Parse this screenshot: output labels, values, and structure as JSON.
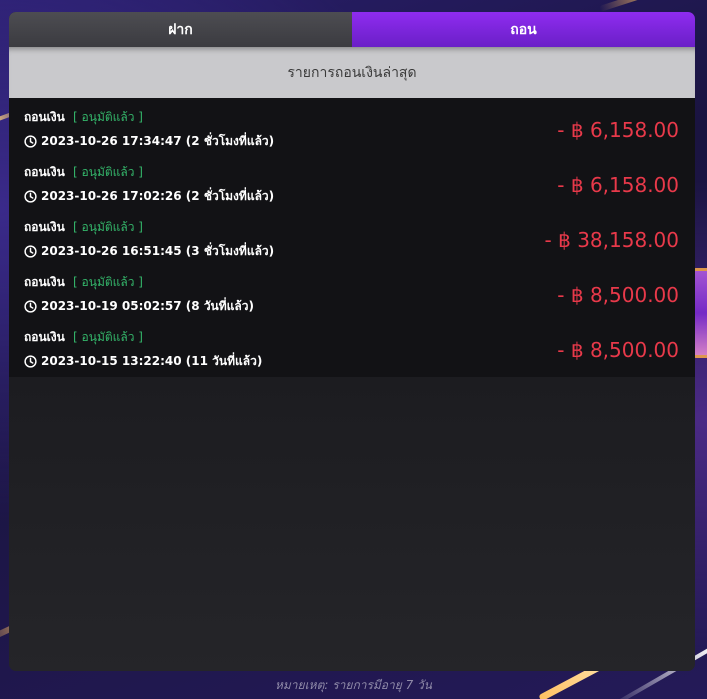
{
  "tabs": {
    "deposit": "ฝาก",
    "withdraw": "ถอน"
  },
  "header_title": "รายการถอนเงินล่าสุด",
  "status_label": "[ อนุมัติแล้ว ]",
  "transactions": [
    {
      "type": "ถอนเงิน",
      "status": "[ อนุมัติแล้ว ]",
      "datetime": "2023-10-26 17:34:47 (2 ชั่วโมงที่แล้ว)",
      "amount": "- ฿ 6,158.00"
    },
    {
      "type": "ถอนเงิน",
      "status": "[ อนุมัติแล้ว ]",
      "datetime": "2023-10-26 17:02:26 (2 ชั่วโมงที่แล้ว)",
      "amount": "- ฿ 6,158.00"
    },
    {
      "type": "ถอนเงิน",
      "status": "[ อนุมัติแล้ว ]",
      "datetime": "2023-10-26 16:51:45 (3 ชั่วโมงที่แล้ว)",
      "amount": "- ฿ 38,158.00"
    },
    {
      "type": "ถอนเงิน",
      "status": "[ อนุมัติแล้ว ]",
      "datetime": "2023-10-19 05:02:57 (8 วันที่แล้ว)",
      "amount": "- ฿ 8,500.00"
    },
    {
      "type": "ถอนเงิน",
      "status": "[ อนุมัติแล้ว ]",
      "datetime": "2023-10-15 13:22:40 (11 วันที่แล้ว)",
      "amount": "- ฿ 8,500.00"
    }
  ],
  "footer_note": "หมายเหตุ: รายการมีอายุ 7 วัน",
  "icons": {
    "time": "clock-icon"
  },
  "colors": {
    "active_tab": "#7b22e0",
    "inactive_tab": "#45454a",
    "approved": "#34b56a",
    "amount": "#e8394a"
  }
}
